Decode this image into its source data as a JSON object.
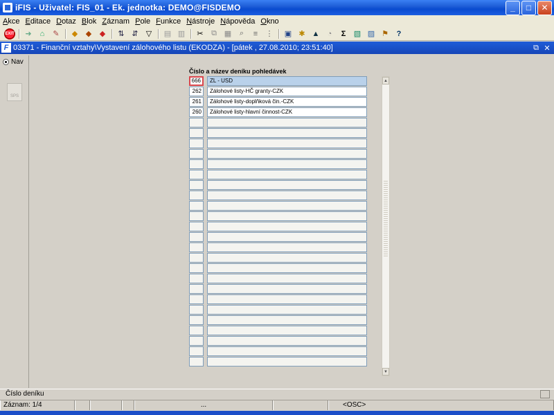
{
  "window": {
    "title": "iFIS - Uživatel: FIS_01 - Ek. jednotka: DEMO@FISDEMO"
  },
  "menu": [
    "Akce",
    "Editace",
    "Dotaz",
    "Blok",
    "Záznam",
    "Pole",
    "Funkce",
    "Nástroje",
    "Nápověda",
    "Okno"
  ],
  "form": {
    "title": "03371 - Finanční vztahy\\Vystavení zálohového listu (EKODZA) - [pátek  , 27.08.2010; 23:51:40]",
    "nav_label": "Nav",
    "nav_button": "SPS",
    "heading": "Číslo a název deníku pohledávek",
    "rows": [
      {
        "num": "666",
        "name": "ZL - USD"
      },
      {
        "num": "262",
        "name": "Zálohové listy-HČ granty-CZK"
      },
      {
        "num": "261",
        "name": "Zálohové listy-doplňková čin.-CZK"
      },
      {
        "num": "260",
        "name": "Zálohové listy-hlavní činnost-CZK"
      }
    ],
    "empty_rows": 24
  },
  "status": {
    "hint": "Číslo deníku",
    "record": "Záznam: 1/4",
    "ellipsis": "...",
    "mode": "<OSC>"
  },
  "toolbar_icons": [
    "exit-icon",
    "save-icon",
    "print-icon",
    "cut-icon",
    "query-icon",
    "filter-icon",
    "sort-asc-icon",
    "sort-desc-icon",
    "sum-icon",
    "excel-icon",
    "help-icon"
  ]
}
